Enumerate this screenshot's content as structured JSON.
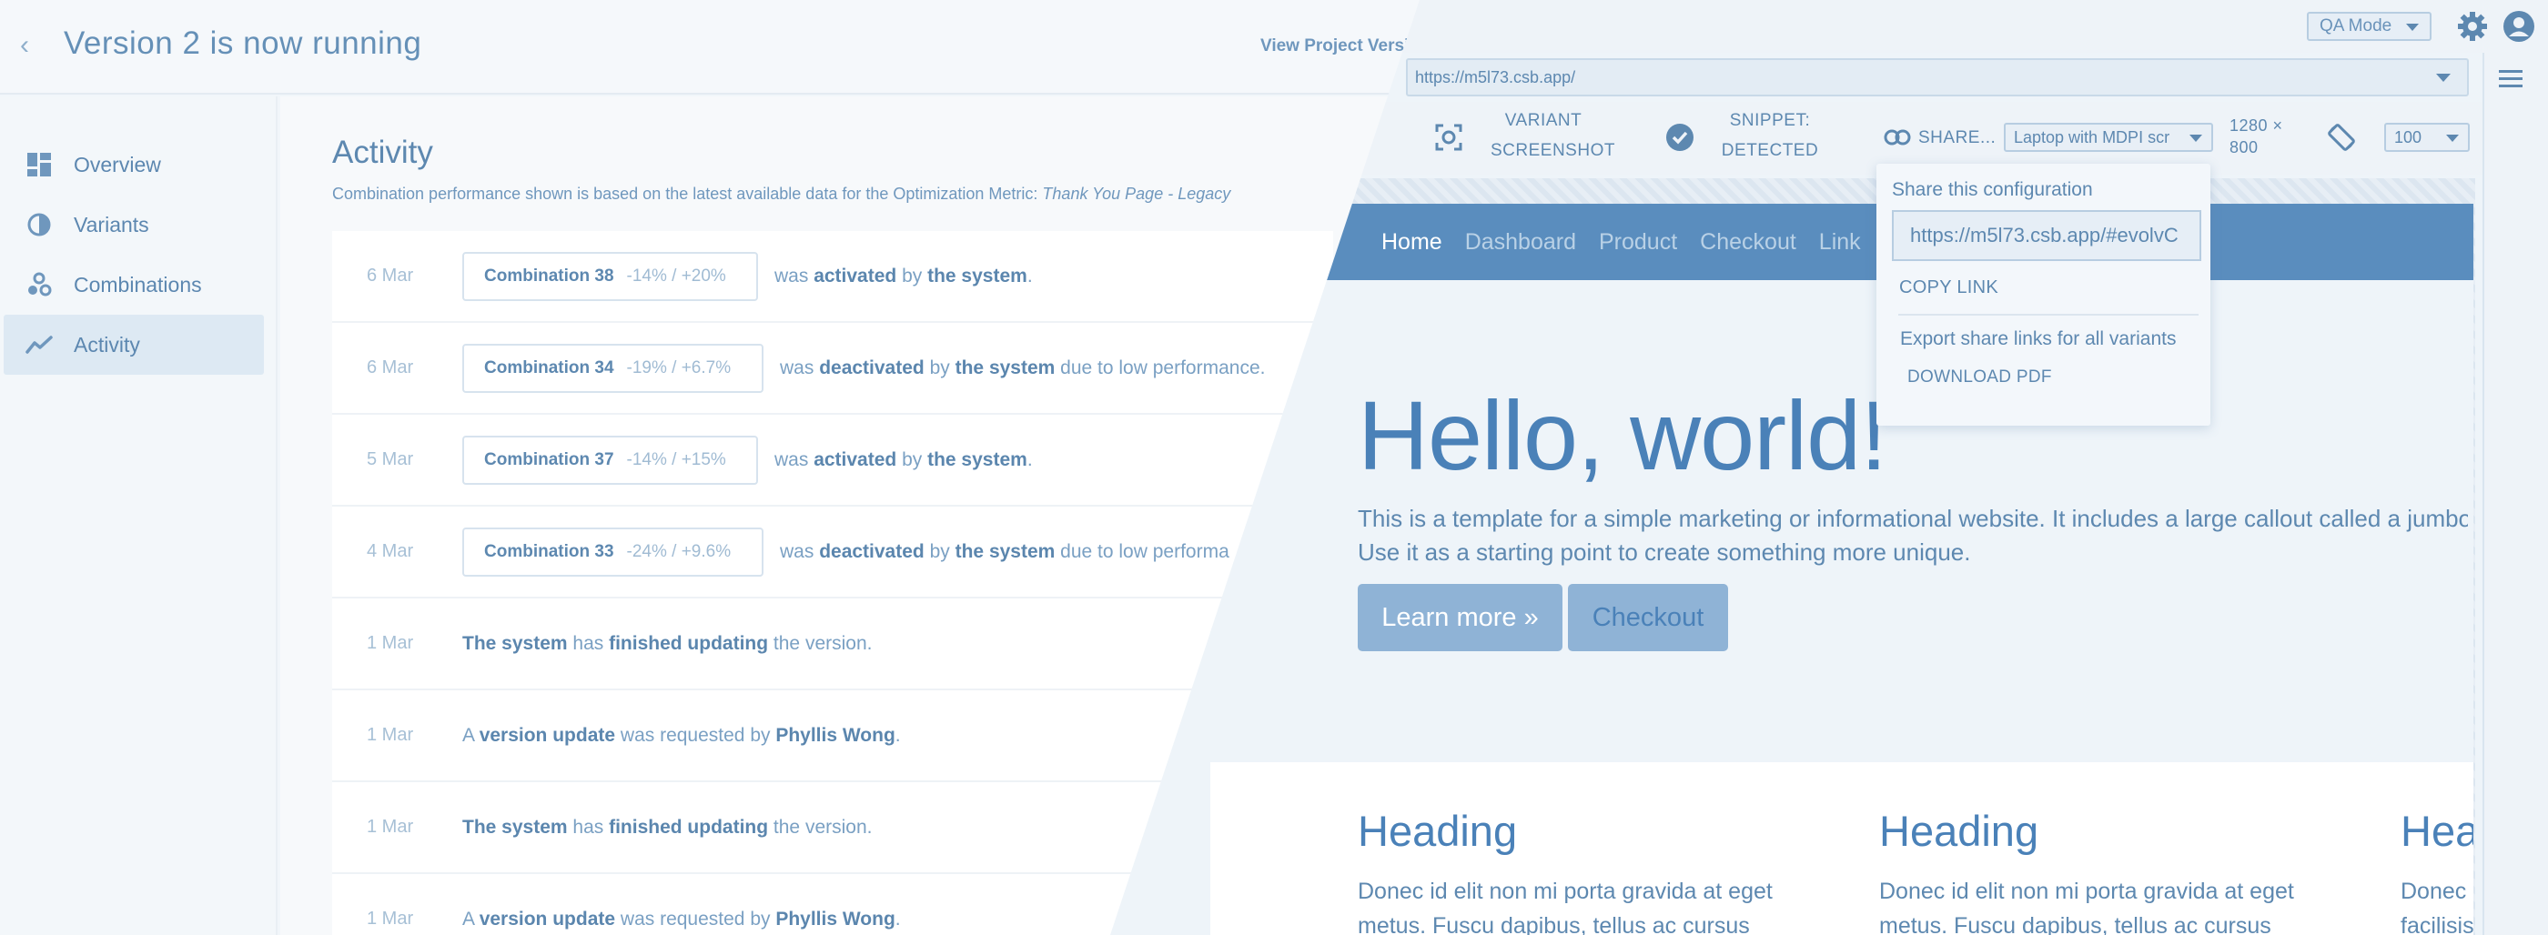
{
  "header": {
    "title": "Version 2 is now running",
    "view_project_version": "View Project Version"
  },
  "sidebar": {
    "items": [
      {
        "label": "Overview",
        "icon": "dashboard-icon",
        "active": false
      },
      {
        "label": "Variants",
        "icon": "half-circle-icon",
        "active": false
      },
      {
        "label": "Combinations",
        "icon": "molecule-icon",
        "active": false
      },
      {
        "label": "Activity",
        "icon": "trend-line-icon",
        "active": true
      }
    ]
  },
  "activity": {
    "title": "Activity",
    "subtitle": "Combination performance shown is based on the latest available data for the Optimization Metric:",
    "subtitle_metric": "Thank You Page - Legacy",
    "rows": [
      {
        "date": "6 Mar",
        "combo": "Combination 38",
        "delta": "-14% / +20%",
        "text_a": "was ",
        "b1": "activated",
        "text_b": " by ",
        "b2": "the system",
        "text_c": "."
      },
      {
        "date": "6 Mar",
        "combo": "Combination 34",
        "delta": "-19% / +6.7%",
        "text_a": "was ",
        "b1": "deactivated",
        "text_b": " by ",
        "b2": "the system",
        "text_c": " due to low performance."
      },
      {
        "date": "5 Mar",
        "combo": "Combination 37",
        "delta": "-14% / +15%",
        "text_a": "was ",
        "b1": "activated",
        "text_b": " by ",
        "b2": "the system",
        "text_c": "."
      },
      {
        "date": "4 Mar",
        "combo": "Combination 33",
        "delta": "-24% / +9.6%",
        "text_a": "was ",
        "b1": "deactivated",
        "text_b": " by ",
        "b2": "the system",
        "text_c": " due to low performa"
      },
      {
        "date": "1 Mar",
        "b1": "The system",
        "text_a": " has ",
        "b2": "finished updating",
        "text_b": " the version."
      },
      {
        "date": "1 Mar",
        "text_a": "A ",
        "b1": "version update",
        "text_b": " was requested by ",
        "b2": "Phyllis Wong",
        "text_c": "."
      },
      {
        "date": "1 Mar",
        "b1": "The system",
        "text_a": " has ",
        "b2": "finished updating",
        "text_b": " the version."
      },
      {
        "date": "1 Mar",
        "text_a": "A ",
        "b1": "version update",
        "text_b": " was requested by ",
        "b2": "Phyllis Wong",
        "text_c": "."
      }
    ]
  },
  "preview": {
    "qa_mode": "QA Mode",
    "url": "https://m5l73.csb.app/",
    "toolbar": {
      "variant_screenshot_1": "VARIANT",
      "variant_screenshot_2": "SCREENSHOT",
      "snippet_1": "SNIPPET:",
      "snippet_2": "DETECTED",
      "share": "SHARE...",
      "device": "Laptop with MDPI scr",
      "resolution_1": "1280 ×",
      "resolution_2": "800",
      "zoom": "100"
    },
    "share_popup": {
      "title": "Share this configuration",
      "link": "https://m5l73.csb.app/#evolvC",
      "copy_link": "COPY LINK",
      "export_text": "Export share links for all variants",
      "download_pdf": "DOWNLOAD PDF"
    },
    "site": {
      "nav": [
        "Home",
        "Dashboard",
        "Product",
        "Checkout",
        "Link"
      ],
      "hero_title": "Hello, world!",
      "hero_line1": "This is a template for a simple marketing or informational website. It includes a large callout called a jumbotron ar",
      "hero_line2": "Use it as a starting point to create something more unique.",
      "learn_more": "Learn more »",
      "checkout": "Checkout",
      "columns": [
        {
          "heading": "Heading",
          "line1": "Donec id elit non mi porta gravida at eget",
          "line2": "metus. Fuscu dapibus, tellus ac cursus"
        },
        {
          "heading": "Heading",
          "line1": "Donec id elit non mi porta gravida at eget",
          "line2": "metus. Fuscu dapibus, tellus ac cursus"
        },
        {
          "heading": "Hea",
          "line1": "Donec",
          "line2": "facilisis"
        }
      ]
    }
  }
}
